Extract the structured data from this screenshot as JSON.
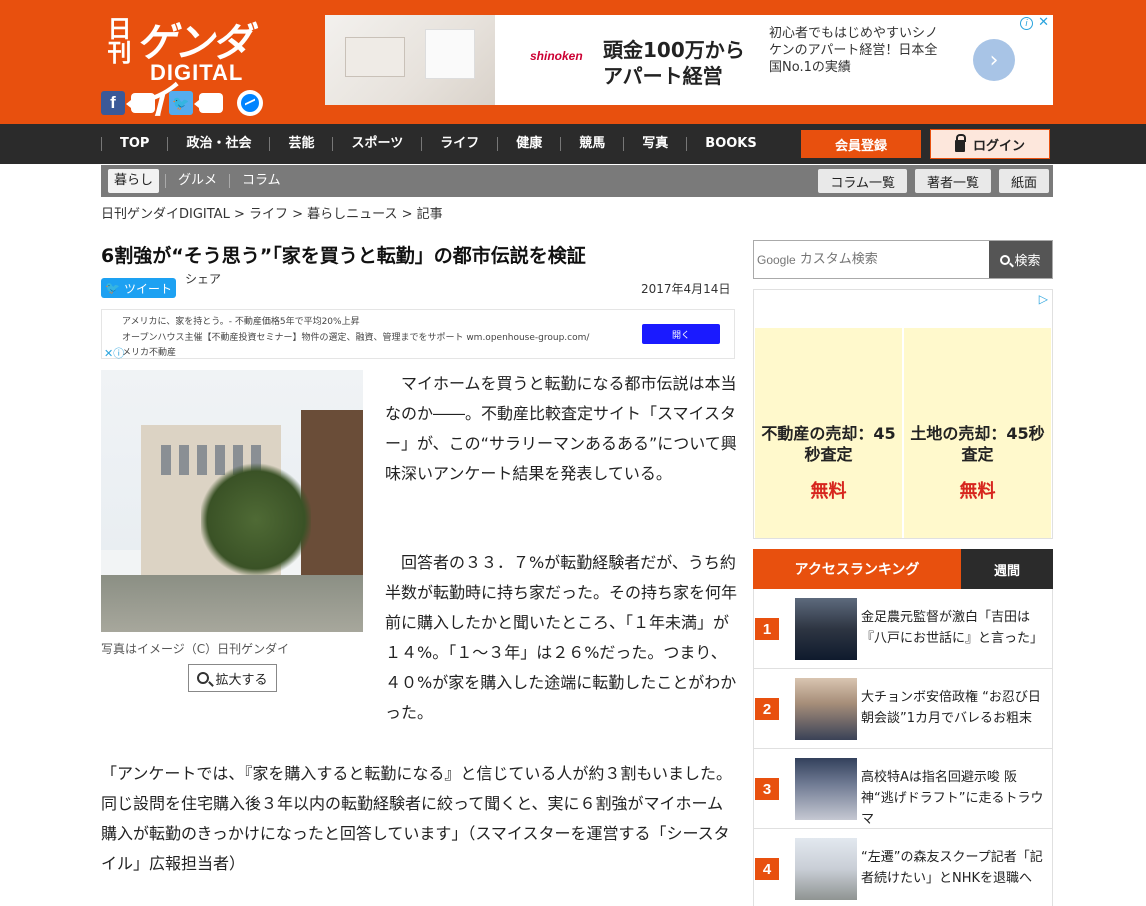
{
  "logo": {
    "nikkan": "日刊",
    "gendai": "ゲンダイ",
    "digital": "DIGITAL"
  },
  "top_ad": {
    "brand": "shinoken",
    "headline_1": "頭金100万から",
    "headline_2": "アパート経営",
    "desc": "初心者でもはじめやすいシノケンのアパート経営！日本全国No.1の実績"
  },
  "nav": {
    "items": [
      "TOP",
      "政治・社会",
      "芸能",
      "スポーツ",
      "ライフ",
      "健康",
      "競馬",
      "写真",
      "BOOKS"
    ],
    "register": "会員登録",
    "login": "ログイン"
  },
  "subnav": {
    "items": [
      "暮らし",
      "グルメ",
      "コラム"
    ],
    "right": [
      "コラム一覧",
      "著者一覧",
      "紙面"
    ]
  },
  "breadcrumb": "日刊ゲンダイDIGITAL > ライフ > 暮らしニュース > 記事",
  "article": {
    "title": "6割強が“そう思う”「家を買うと転勤」の都市伝説を検証",
    "tweet": "ツイート",
    "share": "シェア",
    "date": "2017年4月14日",
    "photo_caption": "写真はイメージ（C）日刊ゲンダイ",
    "zoom": "拡大する",
    "p1": "　マイホームを買うと転勤になる都市伝説は本当なのか――。不動産比較査定サイト「スマイスター」が、この“サラリーマンあるある”について興味深いアンケート結果を発表している。",
    "p2": "　回答者の３３．７%が転勤経験者だが、うち約半数が転勤時に持ち家だった。その持ち家を何年前に購入したかと聞いたところ、「１年未満」が１４%。「１～３年」は２６%だった。つまり、４０%が家を購入した途端に転勤したことがわかった。",
    "p3": "「アンケートでは、『家を購入すると転勤になる』と信じている人が約３割もいました。同じ設問を住宅購入後３年以内の転勤経験者に絞って聞くと、実に６割強がマイホーム購入が転勤のきっかけになったと回答しています」（スマイスターを運営する「シースタイル」広報担当者）"
  },
  "small_ad": {
    "l1": "アメリカに、家を持とう。- 不動産価格5年で平均20%上昇",
    "l2": "オープンハウス主催【不動産投資セミナー】物件の選定、融資、管理までをサポート wm.openhouse-group.com/",
    "l3": "メリカ不動産",
    "open": "開く"
  },
  "search": {
    "google": "Google",
    "placeholder": "カスタム検索",
    "button": "検索"
  },
  "side_ad": {
    "a_title": "不動産の売却：45秒査定",
    "b_title": "土地の売却：45秒査定",
    "free": "無料"
  },
  "ranking": {
    "tab_active": "アクセスランキング",
    "tab_weekly": "週間",
    "items": [
      {
        "num": "1",
        "text": "金足農元監督が激白「吉田は『八戸にお世話に』と言った」"
      },
      {
        "num": "2",
        "text": "大チョンボ安倍政権 “お忍び日朝会談”1カ月でバレるお粗末"
      },
      {
        "num": "3",
        "text": "高校特Aは指名回避示唆 阪神“逃げドラフト”に走るトラウマ"
      },
      {
        "num": "4",
        "text": "“左遷”の森友スクープ記者「記者続けたい」とNHKを退職へ"
      }
    ]
  },
  "colors": {
    "brand": "#e8500e",
    "nav_bg": "#2b2b2b",
    "subnav_bg": "#7a7a7a"
  }
}
